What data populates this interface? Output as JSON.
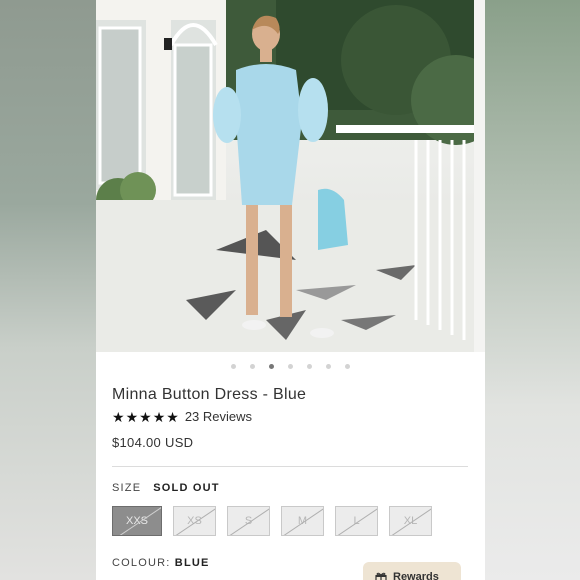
{
  "product": {
    "title": "Minna Button Dress - Blue",
    "rating_stars": 5,
    "reviews_label": "23 Reviews",
    "price": "$104.00 USD"
  },
  "carousel": {
    "dot_count": 7,
    "active_index": 2
  },
  "size": {
    "label": "SIZE",
    "status": "SOLD OUT",
    "options": [
      "XXS",
      "XS",
      "S",
      "M",
      "L",
      "XL"
    ],
    "selected": "XXS"
  },
  "colour": {
    "label": "COLOUR:",
    "value": "BLUE"
  },
  "rewards": {
    "label": "Rewards"
  },
  "colors": {
    "star": "#111111",
    "selected_size_bg": "#8d8d8d",
    "rewards_bg": "#eee4d3"
  }
}
